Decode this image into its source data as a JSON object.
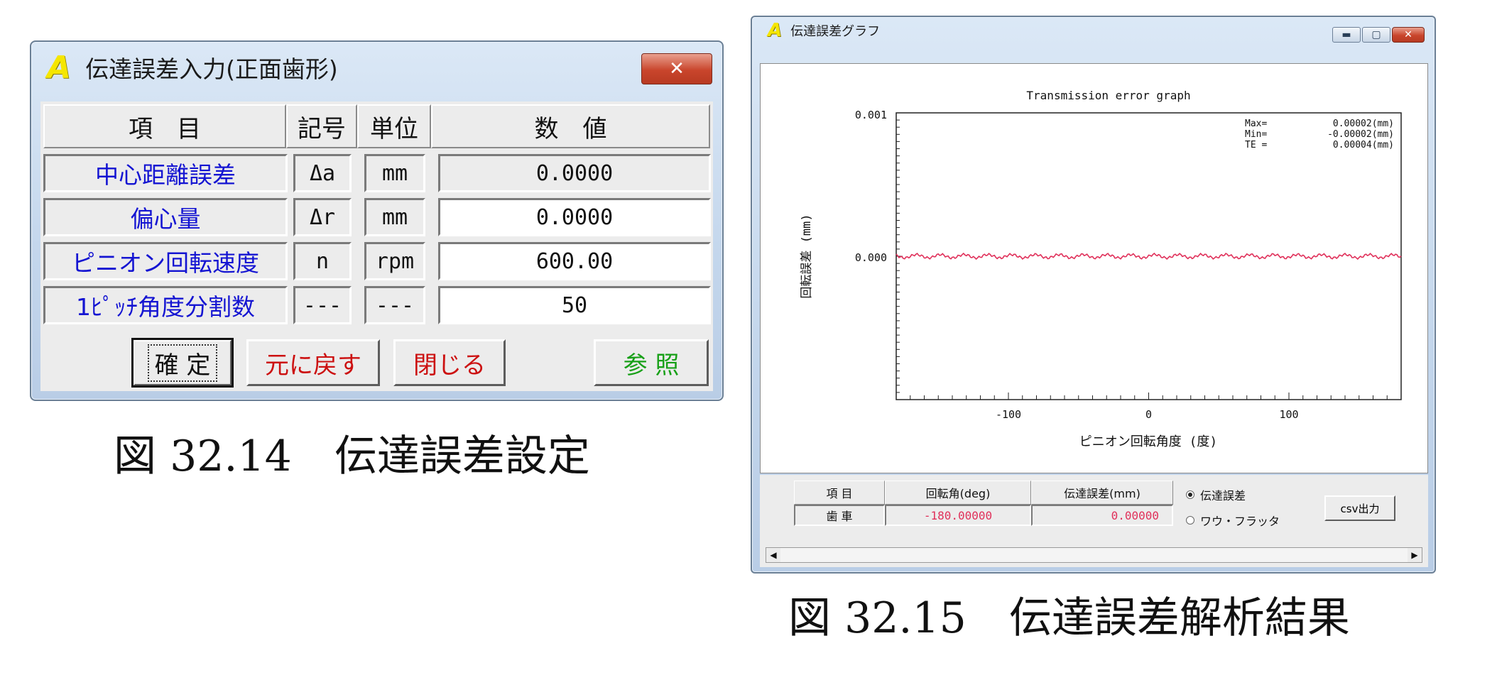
{
  "input_dialog": {
    "title": "伝達誤差入力(正面歯形)",
    "logo": "A",
    "close_symbol": "✕",
    "headers": {
      "item": "項　目",
      "symbol": "記号",
      "unit": "単位",
      "value": "数　値"
    },
    "rows": [
      {
        "label": "中心距離誤差",
        "symbol": "Δa",
        "unit": "mm",
        "value": "0.0000"
      },
      {
        "label": "偏心量",
        "symbol": "Δr",
        "unit": "mm",
        "value": "0.0000"
      },
      {
        "label": "ピニオン回転速度",
        "symbol": "n",
        "unit": "rpm",
        "value": "600.00"
      },
      {
        "label": "1ﾋﾟｯﾁ角度分割数",
        "symbol": "---",
        "unit": "---",
        "value": "50"
      }
    ],
    "buttons": {
      "confirm": "確 定",
      "revert": "元に戻す",
      "close": "閉じる",
      "reference": "参 照"
    }
  },
  "caption_left": "図 32.14　伝達誤差設定",
  "graph_window": {
    "title": "伝達誤差グラフ",
    "logo": "A",
    "minimize_symbol": "▬",
    "maximize_symbol": "▢",
    "close_symbol": "✕",
    "stats": {
      "max_label": "Max=",
      "max_value": "0.00002(mm)",
      "min_label": "Min=",
      "min_value": "-0.00002(mm)",
      "te_label": "TE =",
      "te_value": "0.00004(mm)"
    },
    "table": {
      "col_item": "項 目",
      "col_angle": "回転角(deg)",
      "col_error": "伝達誤差(mm)",
      "row_label": "歯 車",
      "row_angle": "-180.00000",
      "row_error": "0.00000"
    },
    "radio_transmission_error": "伝達誤差",
    "radio_wow_flutter": "ワウ・フラッタ",
    "csv_button": "csv出力",
    "scroll_left": "◀",
    "scroll_right": "▶"
  },
  "caption_right": "図 32.15　伝達誤差解析結果",
  "chart_data": {
    "type": "line",
    "title": "Transmission error graph",
    "xlabel": "ピニオン回転角度 (度)",
    "ylabel": "回転誤差 (mm)",
    "xlim": [
      -180,
      180
    ],
    "ylim": [
      -0.001,
      0.001
    ],
    "x_ticks": [
      -100,
      0,
      100
    ],
    "y_tick_labels": [
      "0.001",
      "0.000"
    ],
    "grid": false,
    "series": [
      {
        "color": "#e0305a",
        "x_range": [
          -180,
          180
        ],
        "y_mean": 0.0,
        "y_amplitude": 2e-05
      }
    ]
  }
}
